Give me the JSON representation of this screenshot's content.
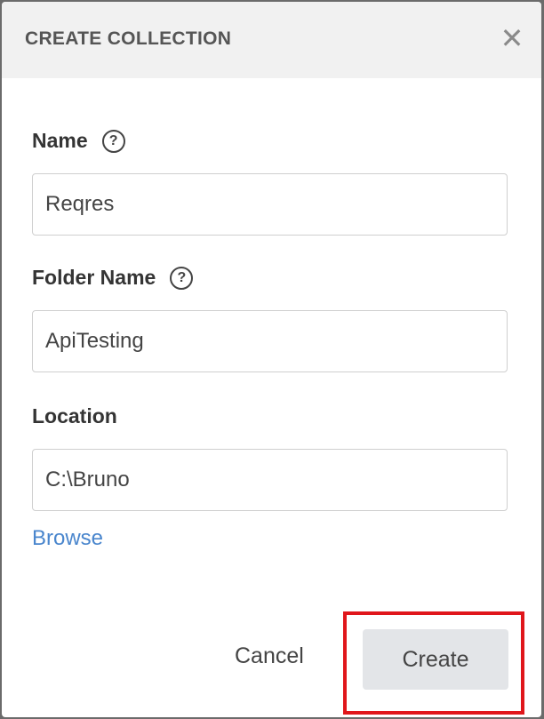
{
  "modal": {
    "title": "CREATE COLLECTION",
    "close_symbol": "✕"
  },
  "fields": {
    "name": {
      "label": "Name",
      "value": "Reqres",
      "help_symbol": "?"
    },
    "folder_name": {
      "label": "Folder Name",
      "value": "ApiTesting",
      "help_symbol": "?"
    },
    "location": {
      "label": "Location",
      "value": "C:\\Bruno"
    }
  },
  "browse_label": "Browse",
  "actions": {
    "cancel_label": "Cancel",
    "create_label": "Create"
  },
  "colors": {
    "accent_link": "#4a86cd",
    "highlight": "#e0161b"
  }
}
